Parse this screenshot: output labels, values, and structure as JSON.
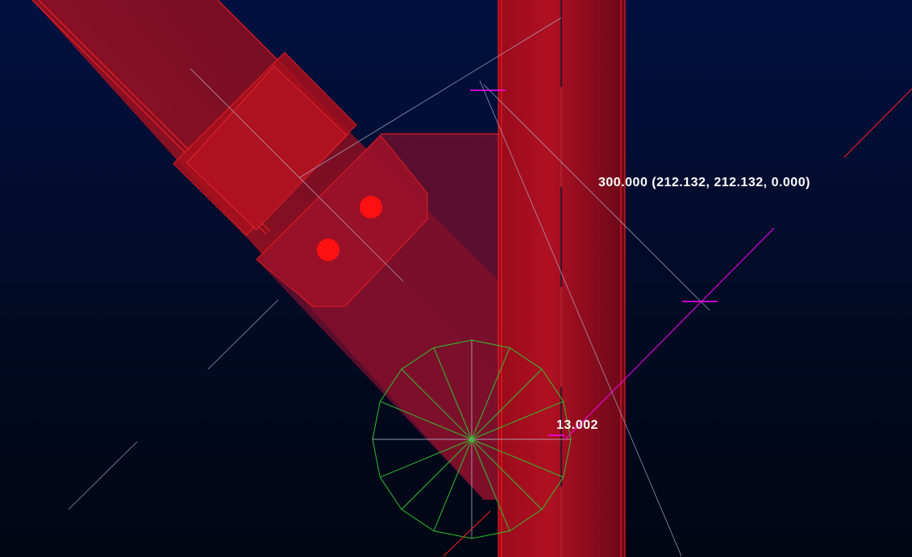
{
  "viewport": {
    "dimension_label": "300.000 (212.132, 212.132, 0.000)",
    "radius_label": "13.002"
  },
  "colors": {
    "member": "#b01020",
    "outline": "#ff2020",
    "snap": "#ff00ff",
    "circle": "#30c030",
    "guide": "#b0b8d0"
  }
}
